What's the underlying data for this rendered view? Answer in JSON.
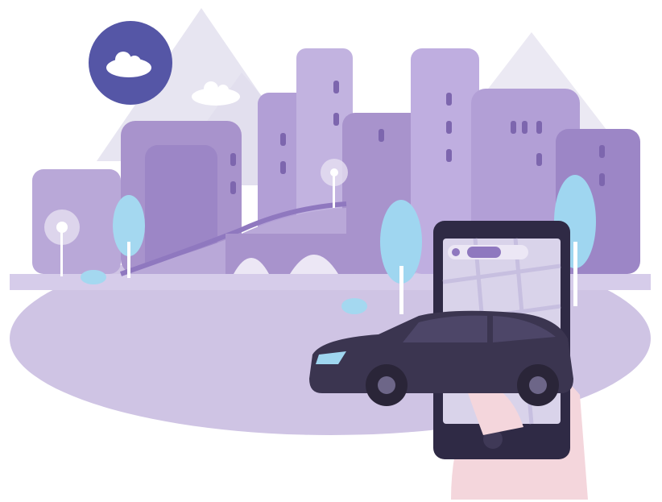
{
  "illustration": {
    "subject": "ride-hailing-app-city",
    "colors": {
      "background": "#ffffff",
      "sky_haze": "#ecebf4",
      "mountain": "#dcdaeb",
      "building_light": "#cbbfe0",
      "building_mid": "#a893cc",
      "building_dark": "#8f78bf",
      "ground": "#cfc4e4",
      "moon": "#5556a6",
      "tree": "#9fd6f0",
      "car": "#3b3550",
      "phone": "#2f2a45",
      "phone_screen": "#d9d3ea",
      "hand": "#f4d6dc"
    }
  }
}
